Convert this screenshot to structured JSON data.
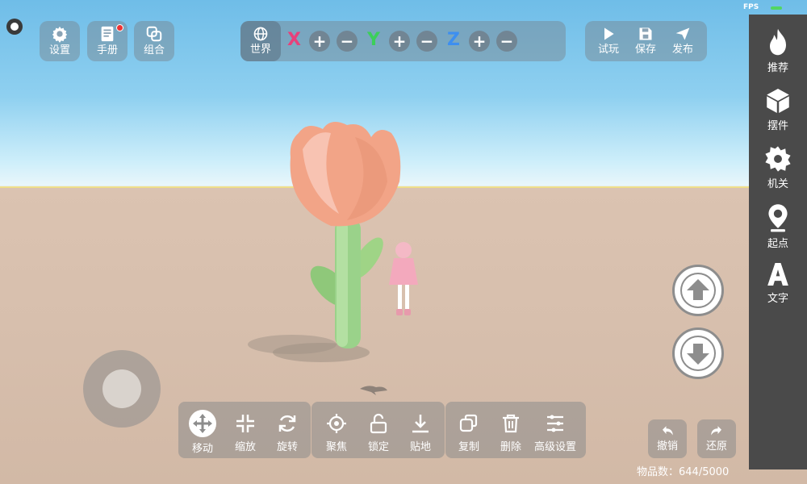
{
  "status": {
    "fps_label": "FPS"
  },
  "topleft": [
    {
      "label": "设置",
      "icon": "gear-icon"
    },
    {
      "label": "手册",
      "icon": "manual-icon"
    },
    {
      "label": "组合",
      "icon": "group-icon"
    }
  ],
  "transform": {
    "space_label": "世界",
    "axes": [
      {
        "name": "X",
        "color": "#e8407a"
      },
      {
        "name": "Y",
        "color": "#3ccf5a"
      },
      {
        "name": "Z",
        "color": "#3d8ff0"
      }
    ],
    "plus": "+",
    "minus": "−"
  },
  "topright": [
    {
      "label": "试玩",
      "icon": "play-icon"
    },
    {
      "label": "保存",
      "icon": "save-icon"
    },
    {
      "label": "发布",
      "icon": "send-icon"
    }
  ],
  "sidebar": [
    {
      "label": "推荐",
      "icon": "fire-icon"
    },
    {
      "label": "摆件",
      "icon": "cube-icon"
    },
    {
      "label": "机关",
      "icon": "gear-flower-icon"
    },
    {
      "label": "起点",
      "icon": "pin-icon"
    },
    {
      "label": "文字",
      "icon": "letter-a-icon"
    }
  ],
  "toolbar_groups": [
    {
      "items": [
        {
          "label": "移动",
          "icon": "move-icon"
        },
        {
          "label": "缩放",
          "icon": "scale-icon"
        },
        {
          "label": "旋转",
          "icon": "rotate-icon"
        }
      ]
    },
    {
      "items": [
        {
          "label": "聚焦",
          "icon": "focus-icon"
        },
        {
          "label": "锁定",
          "icon": "unlock-icon"
        },
        {
          "label": "贴地",
          "icon": "ground-icon"
        }
      ]
    },
    {
      "items": [
        {
          "label": "复制",
          "icon": "copy-icon"
        },
        {
          "label": "删除",
          "icon": "trash-icon"
        },
        {
          "label": "高级设置",
          "icon": "sliders-icon"
        }
      ]
    }
  ],
  "history": {
    "undo": "撤销",
    "redo": "还原"
  },
  "item_count": "物品数：644/5000",
  "colors": {
    "sidebar_bg": "#4a4a4a",
    "panel": "rgba(120,130,140,0.45)",
    "active_tool": "#ffffff"
  }
}
